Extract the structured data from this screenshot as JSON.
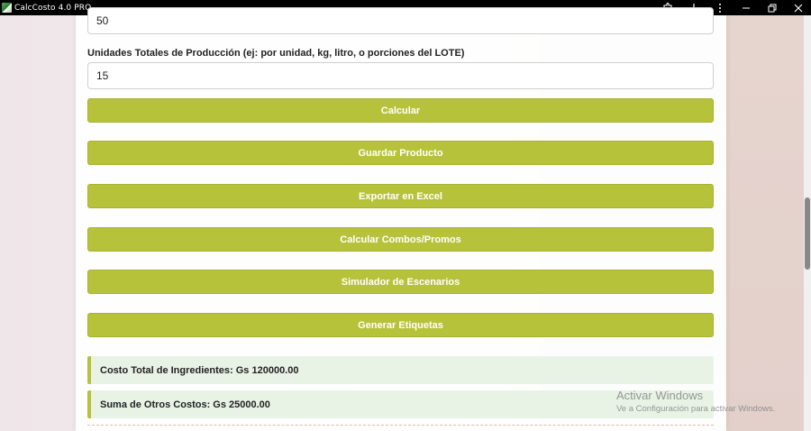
{
  "window": {
    "title": "CalcCosto 4.0 PRO"
  },
  "form": {
    "previous_value": "50",
    "units_label": "Unidades Totales de Producción (ej: por unidad, kg, litro, o porciones del LOTE)",
    "units_value": "15"
  },
  "buttons": {
    "calcular": "Calcular",
    "guardar": "Guardar Producto",
    "exportar": "Exportar en Excel",
    "combos": "Calcular Combos/Promos",
    "simulador": "Simulador de Escenarios",
    "etiquetas": "Generar Etiquetas"
  },
  "results": {
    "ingredientes": "Costo Total de Ingredientes: Gs 120000.00",
    "otros": "Suma de Otros Costos: Gs 25000.00"
  },
  "watermark": {
    "title": "Activar Windows",
    "subtitle": "Ve a Configuración para activar Windows."
  },
  "colors": {
    "accent": "#b7c23b",
    "result_bg": "#e8f3e6"
  }
}
